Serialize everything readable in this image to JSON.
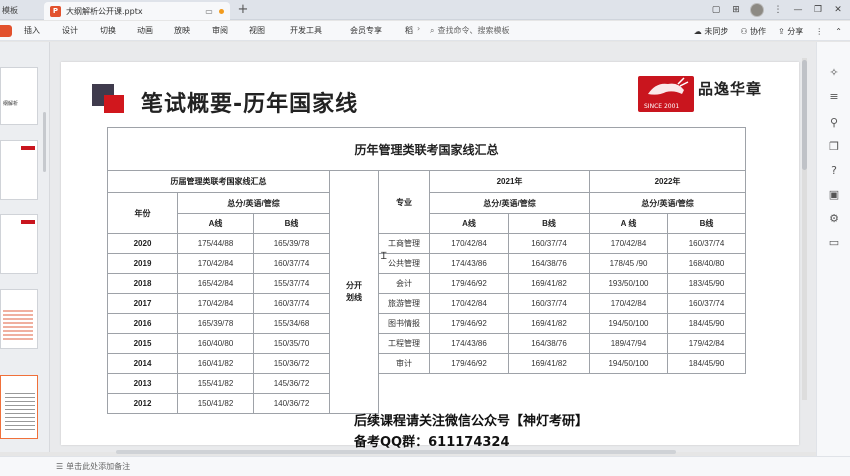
{
  "titlebar": {
    "prev_tab_label": "模板",
    "active_tab_label": "大纲解析公开课.pptx"
  },
  "menubar": {
    "file_label": "",
    "items": [
      "插入",
      "设计",
      "切换",
      "动画",
      "放映",
      "审阅",
      "视图",
      "开发工具",
      "会员专享",
      "稻"
    ],
    "search_label": "查找命令、搜索模板",
    "sync_label": "未同步",
    "collab_label": "协作",
    "share_label": "分享"
  },
  "slide": {
    "title": "笔试概要-历年国家线",
    "logo_name": "品逸华章",
    "logo_since": "SINCE 2001",
    "table_title": "历年管理类联考国家线汇总",
    "left_header": "历届管理类联考国家线汇总",
    "col_year": "年份",
    "col_total": "总分/英语/管综",
    "col_a": "A线",
    "col_b": "B线",
    "mid_label": "分开划线",
    "col_major": "专业",
    "year_2021": "2021年",
    "year_2022": "2022年",
    "col_a_2022": "A 线",
    "left_rows": [
      {
        "year": "2020",
        "a": "175/44/88",
        "b": "165/39/78"
      },
      {
        "year": "2019",
        "a": "170/42/84",
        "b": "160/37/74"
      },
      {
        "year": "2018",
        "a": "165/42/84",
        "b": "155/37/74"
      },
      {
        "year": "2017",
        "a": "170/42/84",
        "b": "160/37/74"
      },
      {
        "year": "2016",
        "a": "165/39/78",
        "b": "155/34/68"
      },
      {
        "year": "2015",
        "a": "160/40/80",
        "b": "150/35/70"
      },
      {
        "year": "2014",
        "a": "160/41/82",
        "b": "150/36/72"
      },
      {
        "year": "2013",
        "a": "155/41/82",
        "b": "145/36/72"
      },
      {
        "year": "2012",
        "a": "150/41/82",
        "b": "140/36/72"
      }
    ],
    "right_rows": [
      {
        "major": "工商管理",
        "a21": "170/42/84",
        "b21": "160/37/74",
        "a22": "170/42/84",
        "b22": "160/37/74"
      },
      {
        "major": "公共管理",
        "a21": "174/43/86",
        "b21": "164/38/76",
        "a22": "178/45 /90",
        "b22": "168/40/80"
      },
      {
        "major": "会计",
        "a21": "179/46/92",
        "b21": "169/41/82",
        "a22": "193/50/100",
        "b22": "183/45/90"
      },
      {
        "major": "旅游管理",
        "a21": "170/42/84",
        "b21": "160/37/74",
        "a22": "170/42/84",
        "b22": "160/37/74"
      },
      {
        "major": "图书情报",
        "a21": "179/46/92",
        "b21": "169/41/82",
        "a22": "194/50/100",
        "b22": "184/45/90"
      },
      {
        "major": "工程管理",
        "a21": "174/43/86",
        "b21": "164/38/76",
        "a22": "189/47/94",
        "b22": "179/42/84"
      },
      {
        "major": "审计",
        "a21": "179/46/92",
        "b21": "169/41/82",
        "a22": "194/50/100",
        "b22": "184/45/90"
      }
    ]
  },
  "overlay": {
    "line1": "后续课程请关注微信公众号【神灯考研】",
    "line2": "备考QQ群：611174324"
  },
  "statusbar": {
    "notes_label": "单击此处添加备注"
  },
  "thumbs": {
    "t1": "纲解析"
  }
}
